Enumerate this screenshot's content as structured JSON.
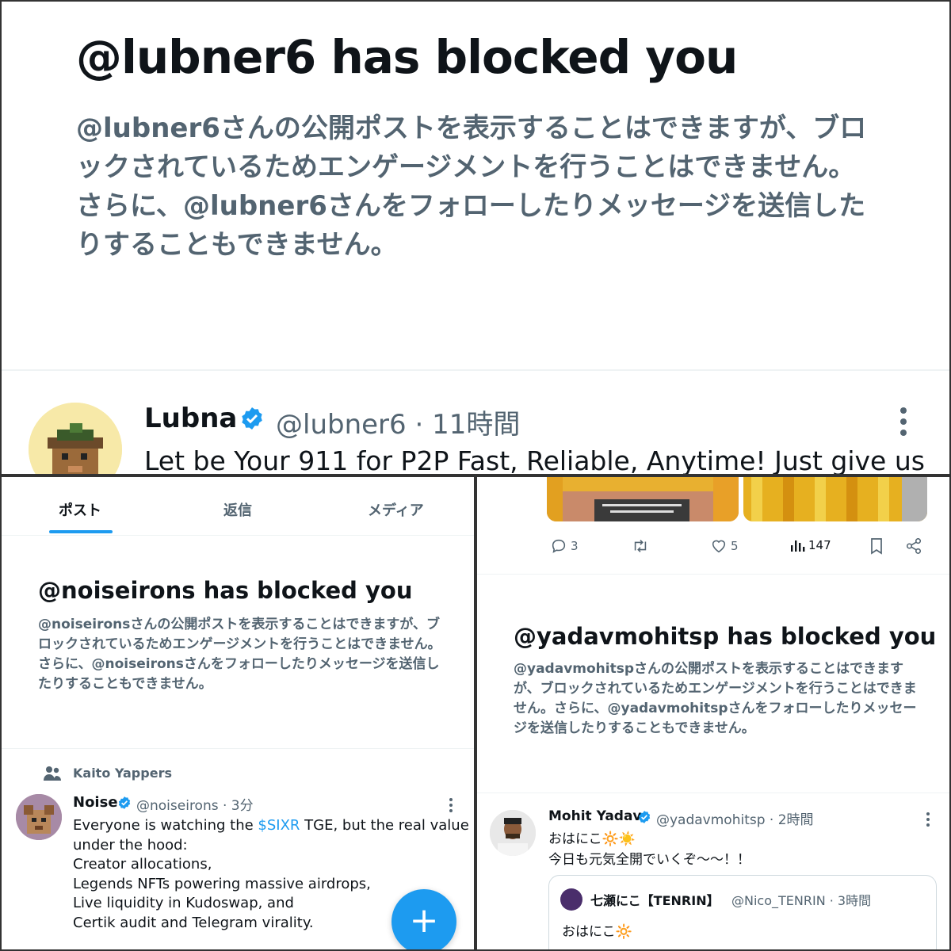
{
  "panel1": {
    "title": "@lubner6 has blocked you",
    "description": "@lubner6さんの公開ポストを表示することはできますが、ブロックされているためエンゲージメントを行うことはできません。さらに、@lubner6さんをフォローしたりメッセージを送信したりすることもできません。",
    "tweet": {
      "name": "Lubna",
      "handle_time": "@lubner6 · 11時間",
      "text": "Let be Your 911 for P2P Fast, Reliable, Anytime! Just give us"
    }
  },
  "panel2": {
    "tabs": [
      {
        "label": "ポスト",
        "active": true
      },
      {
        "label": "返信",
        "active": false
      },
      {
        "label": "メディア",
        "active": false
      }
    ],
    "title": "@noiseirons has blocked you",
    "description": "@noiseironsさんの公開ポストを表示することはできますが、ブロックされているためエンゲージメントを行うことはできません。さらに、@noiseironsさんをフォローしたりメッセージを送信したりすることもできません。",
    "social_context": "Kaito Yappers",
    "tweet": {
      "name": "Noise",
      "handle_time": "@noiseirons · 3分",
      "line1_before": "Everyone is watching the ",
      "line1_cashtag": "$SIXR",
      "line1_after": " TGE, but the real value sits",
      "lines": [
        "under the hood:",
        "Creator allocations,",
        "Legends NFTs powering massive airdrops,",
        "Live liquidity in Kudoswap, and",
        "Certik audit and Telegram virality."
      ]
    },
    "fab_label": "+"
  },
  "panel3": {
    "actions": {
      "replies": "3",
      "retweets": "",
      "likes": "5",
      "views": "147"
    },
    "title": "@yadavmohitsp has blocked you",
    "description": "@yadavmohitspさんの公開ポストを表示することはできますが、ブロックされているためエンゲージメントを行うことはできません。さらに、@yadavmohitspさんをフォローしたりメッセージを送信したりすることもできません。",
    "tweet": {
      "name": "Mohit Yadav",
      "handle_time": "@yadavmohitsp · 2時間",
      "line1": "おはにこ🔆☀️",
      "line2": "今日も元気全開でいくぞ〜〜！！"
    },
    "quote": {
      "name": "七瀬にこ【TENRIN】",
      "handle_time": "@Nico_TENRIN · 3時間",
      "text": "おはにこ🔆"
    }
  },
  "colors": {
    "accent": "#1d9bf0",
    "secondary_text": "#536471",
    "primary_text": "#0f1419"
  }
}
